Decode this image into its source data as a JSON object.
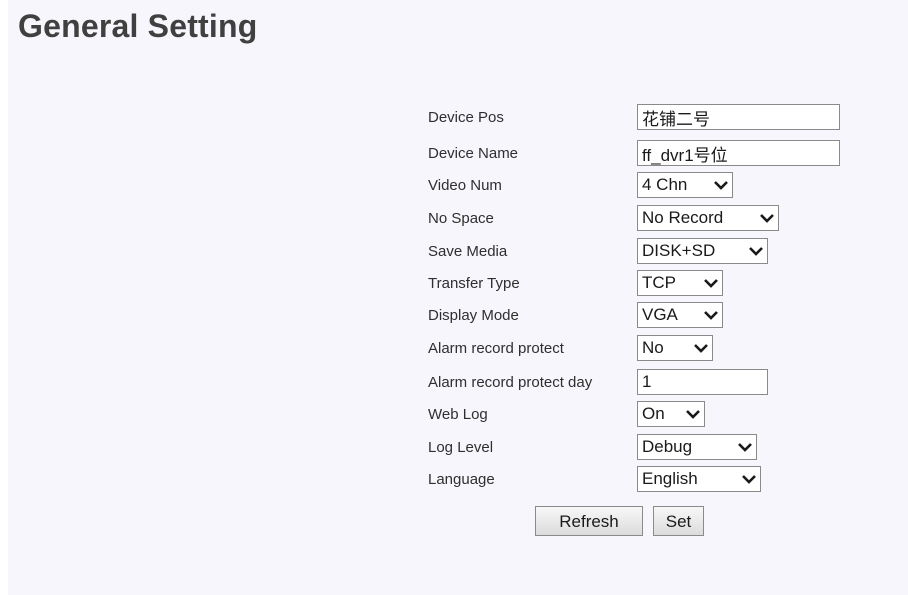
{
  "page": {
    "title": "General Setting"
  },
  "form": {
    "device_pos": {
      "label": "Device Pos",
      "value": "花铺二号"
    },
    "device_name": {
      "label": "Device Name",
      "value": "ff_dvr1号位"
    },
    "video_num": {
      "label": "Video Num",
      "selected": "4 Chn"
    },
    "no_space": {
      "label": "No Space",
      "selected": "No Record"
    },
    "save_media": {
      "label": "Save Media",
      "selected": "DISK+SD"
    },
    "transfer_type": {
      "label": "Transfer Type",
      "selected": "TCP"
    },
    "display_mode": {
      "label": "Display Mode",
      "selected": "VGA"
    },
    "alarm_record_protect": {
      "label": "Alarm record protect",
      "selected": "No"
    },
    "alarm_record_protect_day": {
      "label": "Alarm record protect day",
      "value": "1"
    },
    "web_log": {
      "label": "Web Log",
      "selected": "On"
    },
    "log_level": {
      "label": "Log Level",
      "selected": "Debug"
    },
    "language": {
      "label": "Language",
      "selected": "English"
    }
  },
  "buttons": {
    "refresh": "Refresh",
    "set": "Set"
  },
  "icons": {
    "dropdown": "chevron-down-icon"
  },
  "colors": {
    "panel_background": "#f6f6fc",
    "title_text": "#404040"
  }
}
